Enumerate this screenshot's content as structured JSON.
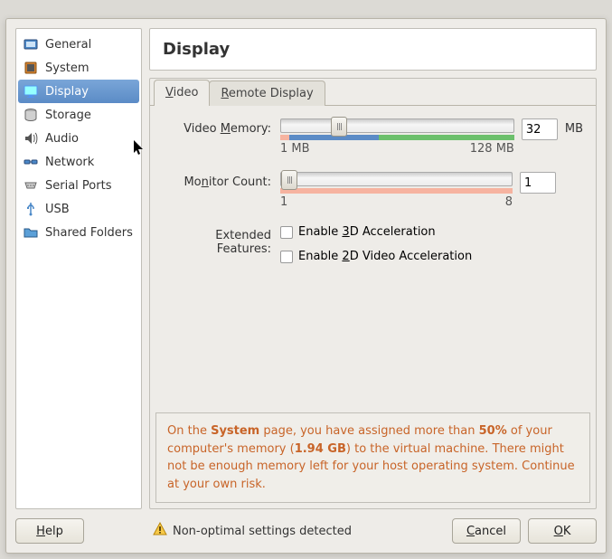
{
  "sidebar": {
    "items": [
      {
        "label": "General"
      },
      {
        "label": "System"
      },
      {
        "label": "Display"
      },
      {
        "label": "Storage"
      },
      {
        "label": "Audio"
      },
      {
        "label": "Network"
      },
      {
        "label": "Serial Ports"
      },
      {
        "label": "USB"
      },
      {
        "label": "Shared Folders"
      }
    ],
    "selected_index": 2
  },
  "title": "Display",
  "tabs": {
    "items": [
      {
        "label_pre": "",
        "label_u": "V",
        "label_post": "ideo"
      },
      {
        "label_pre": "",
        "label_u": "R",
        "label_post": "emote Display"
      }
    ],
    "active_index": 0
  },
  "video_memory": {
    "label_pre": "Video ",
    "label_u": "M",
    "label_post": "emory:",
    "value": "32",
    "unit": "MB",
    "min_label": "1 MB",
    "max_label": "128 MB",
    "slider_percent": 25,
    "usage": [
      {
        "cls": "pink",
        "w": 4
      },
      {
        "cls": "blue",
        "w": 38
      },
      {
        "cls": "green",
        "w": 58
      }
    ]
  },
  "monitor_count": {
    "label_pre": "Mo",
    "label_u": "n",
    "label_post": "itor Count:",
    "value": "1",
    "min_label": "1",
    "max_label": "8",
    "slider_percent": 0,
    "usage": [
      {
        "cls": "pink",
        "w": 100
      }
    ]
  },
  "extended": {
    "label": "Extended Features:",
    "opts": [
      {
        "pre": "Enable ",
        "u": "3",
        "post": "D Acceleration",
        "checked": false
      },
      {
        "pre": "Enable ",
        "u": "2",
        "post": "D Video Acceleration",
        "checked": false
      }
    ]
  },
  "warning": {
    "p1a": "On the ",
    "p1b": "System",
    "p1c": " page, you have assigned more than ",
    "p1d": "50%",
    "p1e": " of your computer's memory (",
    "p1f": "1.94 GB",
    "p1g": ") to the virtual machine. There might not be enough memory left for your host operating system. Continue at your own risk."
  },
  "footer": {
    "help_u": "H",
    "help_post": "elp",
    "status": "Non-optimal settings detected",
    "cancel_u": "C",
    "cancel_post": "ancel",
    "ok_u": "O",
    "ok_post": "K"
  }
}
